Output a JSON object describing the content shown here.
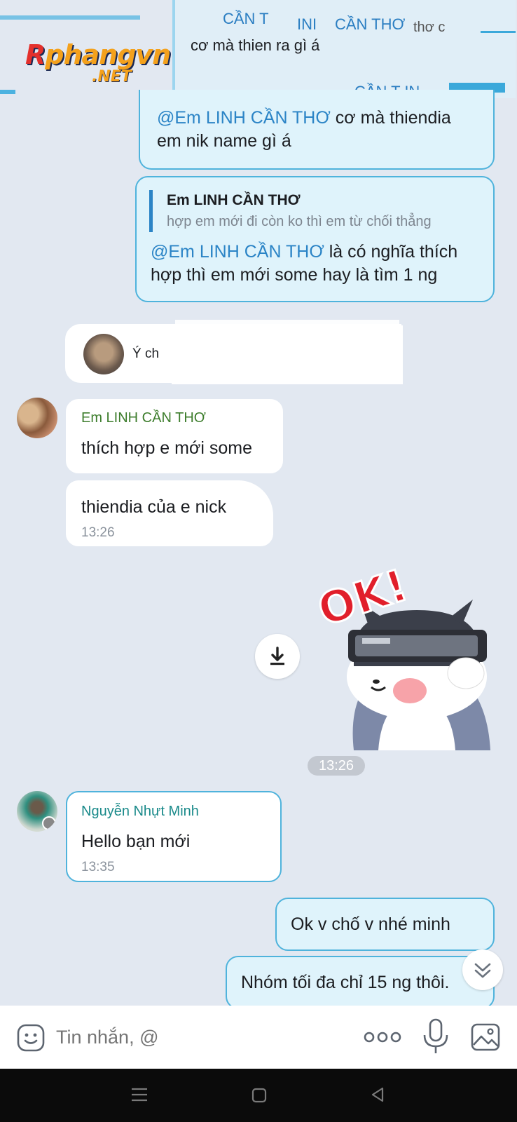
{
  "watermark": {
    "logo_main": "Rphangvn",
    "logo_sub": ".NET"
  },
  "top_fragment": {
    "line1_a": "CẦN T",
    "line1_b": "INI",
    "line1_c": "CẦN THƠ",
    "line1_d": "thơ c",
    "line2": "cơ mà thien    ra gì á",
    "line3": "CẦN T  IN"
  },
  "messages": {
    "reply1": {
      "mention": "@Em LINH CẦN THƠ",
      "text_a": " cơ mà thiendia",
      "text_b": "em nik name gì á"
    },
    "reply2": {
      "quote_name": "Em LINH CẦN THƠ",
      "quote_text": "hợp em mới đi còn ko thì em từ chối thẳng",
      "mention": "@Em LINH CẦN THƠ",
      "text_a": " là có nghĩa thích",
      "text_b": "hợp thì em mới some hay là tìm 1 ng"
    },
    "card": {
      "text": "Ý ch"
    },
    "linh1": {
      "sender": "Em LINH CẦN THƠ",
      "text": "thích hợp e mới some"
    },
    "linh2": {
      "text": "thiendia của e nick",
      "time": "13:26"
    },
    "sticker": {
      "text": "OK!",
      "time": "13:26"
    },
    "minh": {
      "sender": "Nguyễn Nhựt Minh",
      "text": "Hello bạn mới",
      "time": "13:35"
    },
    "out1": {
      "text": "Ok v chố v nhé minh"
    },
    "out2": {
      "text": "Nhóm tối đa chỉ 15 ng thôi."
    }
  },
  "input": {
    "placeholder": "Tin nhắn, @"
  },
  "icons": {
    "emoji": "emoji-icon",
    "more": "more-dots-icon",
    "mic": "microphone-icon",
    "image": "image-icon",
    "download": "download-icon",
    "scroll": "chevron-double-down-icon"
  },
  "colors": {
    "accent": "#2b84c6",
    "bubble_out": "#dff3fb",
    "bubble_border": "#4fb3dc",
    "bg": "#e2e8f1"
  }
}
